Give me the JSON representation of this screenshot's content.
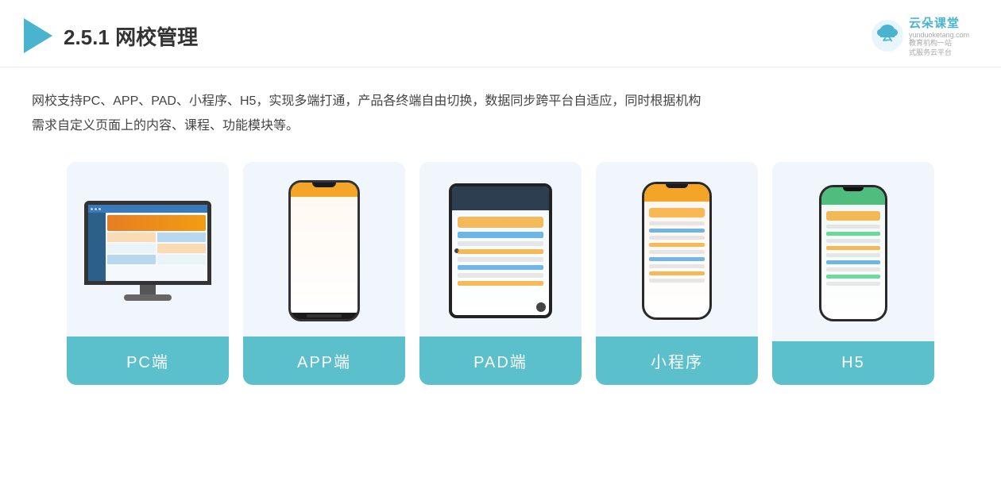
{
  "header": {
    "title_prefix": "2.5.1 ",
    "title_main": "网校管理",
    "logo_text": "云朵课堂",
    "logo_url": "yunduoketang.com",
    "logo_tagline1": "教育机构一站",
    "logo_tagline2": "式服务云平台"
  },
  "description": {
    "text1": "网校支持PC、APP、PAD、小程序、H5，实现多端打通，产品各终端自由切换，数据同步跨平台自适应，同时根据机构",
    "text2": "需求自定义页面上的内容、课程、功能模块等。"
  },
  "cards": [
    {
      "id": "pc",
      "label": "PC端"
    },
    {
      "id": "app",
      "label": "APP端"
    },
    {
      "id": "pad",
      "label": "PAD端"
    },
    {
      "id": "miniapp",
      "label": "小程序"
    },
    {
      "id": "h5",
      "label": "H5"
    }
  ]
}
